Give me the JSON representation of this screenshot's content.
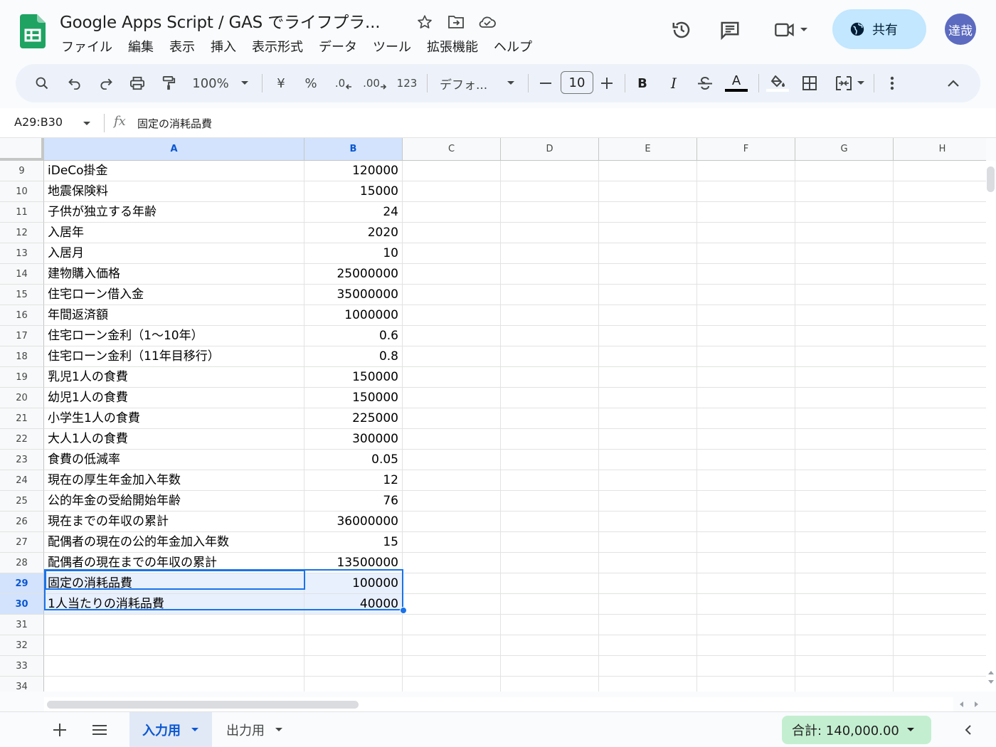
{
  "document": {
    "title": "Google Apps Script / GAS でライフプラ..."
  },
  "menu": [
    "ファイル",
    "編集",
    "表示",
    "挿入",
    "表示形式",
    "データ",
    "ツール",
    "拡張機能",
    "ヘルプ"
  ],
  "share": {
    "label": "共有"
  },
  "user": {
    "avatar_text": "達哉"
  },
  "toolbar": {
    "zoom": "100%",
    "currency": "¥",
    "percent": "%",
    "dec_decrease": ".0",
    "dec_increase": ".00",
    "number_format": "123",
    "font": "デフォ...",
    "font_size": "10",
    "bold": "B",
    "italic": "I",
    "text_color_letter": "A"
  },
  "formula_bar": {
    "name_box": "A29:B30",
    "fx": "fx",
    "value": "固定の消耗品費"
  },
  "columns": [
    "A",
    "B",
    "C",
    "D",
    "E",
    "F",
    "G",
    "H"
  ],
  "rows": [
    {
      "n": "9",
      "a": "iDeCo掛金",
      "b": "120000"
    },
    {
      "n": "10",
      "a": "地震保険料",
      "b": "15000"
    },
    {
      "n": "11",
      "a": "子供が独立する年齢",
      "b": "24"
    },
    {
      "n": "12",
      "a": "入居年",
      "b": "2020"
    },
    {
      "n": "13",
      "a": "入居月",
      "b": "10"
    },
    {
      "n": "14",
      "a": "建物購入価格",
      "b": "25000000"
    },
    {
      "n": "15",
      "a": "住宅ローン借入金",
      "b": "35000000"
    },
    {
      "n": "16",
      "a": "年間返済額",
      "b": "1000000"
    },
    {
      "n": "17",
      "a": "住宅ローン金利（1〜10年）",
      "b": "0.6"
    },
    {
      "n": "18",
      "a": "住宅ローン金利（11年目移行）",
      "b": "0.8"
    },
    {
      "n": "19",
      "a": "乳児1人の食費",
      "b": "150000"
    },
    {
      "n": "20",
      "a": "幼児1人の食費",
      "b": "150000"
    },
    {
      "n": "21",
      "a": "小学生1人の食費",
      "b": "225000"
    },
    {
      "n": "22",
      "a": "大人1人の食費",
      "b": "300000"
    },
    {
      "n": "23",
      "a": "食費の低減率",
      "b": "0.05"
    },
    {
      "n": "24",
      "a": "現在の厚生年金加入年数",
      "b": "12"
    },
    {
      "n": "25",
      "a": "公的年金の受給開始年齢",
      "b": "76"
    },
    {
      "n": "26",
      "a": "現在までの年収の累計",
      "b": "36000000"
    },
    {
      "n": "27",
      "a": "配偶者の現在の公的年金加入年数",
      "b": "15"
    },
    {
      "n": "28",
      "a": "配偶者の現在までの年収の累計",
      "b": "13500000"
    },
    {
      "n": "29",
      "a": "固定の消耗品費",
      "b": "100000",
      "selected": true
    },
    {
      "n": "30",
      "a": "1人当たりの消耗品費",
      "b": "40000",
      "selected": true
    },
    {
      "n": "31",
      "a": "",
      "b": ""
    },
    {
      "n": "32",
      "a": "",
      "b": ""
    },
    {
      "n": "33",
      "a": "",
      "b": ""
    },
    {
      "n": "34",
      "a": "",
      "b": ""
    }
  ],
  "sheets": [
    {
      "name": "入力用",
      "active": true
    },
    {
      "name": "出力用",
      "active": false
    }
  ],
  "sum": {
    "label": "合計: 140,000.00"
  },
  "colors": {
    "accent": "#1a73e8",
    "share_bg": "#c2e7ff",
    "sum_bg": "#c4eed0",
    "selection_header": "#d3e3fd"
  }
}
